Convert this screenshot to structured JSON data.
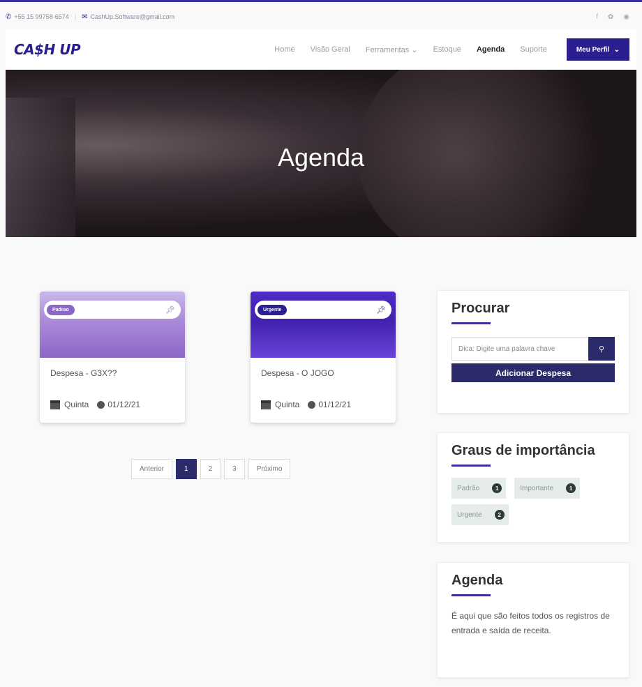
{
  "topbar": {
    "phone": "+55 15 99758-6574",
    "email": "CashUp.Software@gmail.com",
    "social": [
      "facebook-icon",
      "twitter-icon",
      "instagram-icon"
    ]
  },
  "nav": {
    "logo": "CA$H UP",
    "items": [
      "Home",
      "Visão Geral",
      "Ferramentas",
      "Estoque",
      "Agenda",
      "Suporte"
    ],
    "active": "Agenda",
    "profile_label": "Meu Perfil"
  },
  "hero": {
    "title": "Agenda"
  },
  "cards": [
    {
      "badge": "Padrao",
      "title": "Despesa - G3X??",
      "day": "Quinta",
      "date": "01/12/21"
    },
    {
      "badge": "Urgente",
      "title": "Despesa - O JOGO",
      "day": "Quinta",
      "date": "01/12/21"
    }
  ],
  "pager": {
    "prev": "Anterior",
    "pages": [
      "1",
      "2",
      "3"
    ],
    "current": "1",
    "next": "Próximo"
  },
  "search": {
    "title": "Procurar",
    "placeholder": "Dica: Digite uma palavra chave",
    "add_label": "Adicionar Despesa"
  },
  "importance": {
    "title": "Graus de importância",
    "tags": [
      {
        "label": "Padrão",
        "count": "1"
      },
      {
        "label": "Importante",
        "count": "1"
      },
      {
        "label": "Urgente",
        "count": "2"
      }
    ]
  },
  "agenda_info": {
    "title": "Agenda",
    "text": "É aqui que são feitos todos os registros de entrada e saída de receita."
  },
  "colors": {
    "accent": "#2b1e8f",
    "dark_button": "#2b2a6b",
    "padrao": "#8d67c8",
    "urgente": "#4322b0"
  }
}
